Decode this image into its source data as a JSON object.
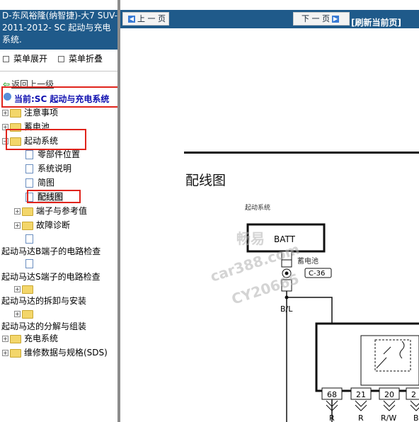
{
  "left": {
    "title": "D-东风裕隆(纳智捷)-大7 SUV-2011-2012- SC 起动与充电系统.",
    "menu_expand": "菜单展开",
    "menu_collapse": "菜单折叠",
    "back": "返回上一级",
    "current": "当前:SC 起动与充电系统",
    "tree": {
      "notes": "注意事项",
      "battery": "蓄电池",
      "starting_system": "起动系统",
      "component_location": "零部件位置",
      "system_description": "系统说明",
      "schematic": "简图",
      "wiring_diagram": "配线图",
      "terminals": "端子与参考值",
      "diagnosis": "故障诊断",
      "b_terminal_check": "起动马达B端子的电路检查",
      "s_terminal_check": "起动马达S端子的电路检查",
      "removal_install": "起动马达的拆卸与安装",
      "disassembly": "起动马达的分解与组装",
      "charging_system": "充电系统",
      "specs": "维修数据与规格(SDS)"
    }
  },
  "right": {
    "prev": "上 一 页",
    "next": "下 一 页",
    "refresh": "[刷新当前页]",
    "diagram_title": "配线图",
    "system_label": "起动系统",
    "batt": "BATT",
    "battery_label": "蓄电池",
    "connector": "C-36",
    "wire_bl": "B/L",
    "pins": [
      "68",
      "21",
      "20",
      "2"
    ],
    "wire_colors": [
      "R",
      "R",
      "R/W",
      "B"
    ],
    "watermark": [
      "畅易",
      "car388.com",
      "CY20665"
    ]
  },
  "colors": {
    "title_bg": "#1f5a8a",
    "highlight": "#e0241c",
    "current_text": "#1010b0"
  }
}
